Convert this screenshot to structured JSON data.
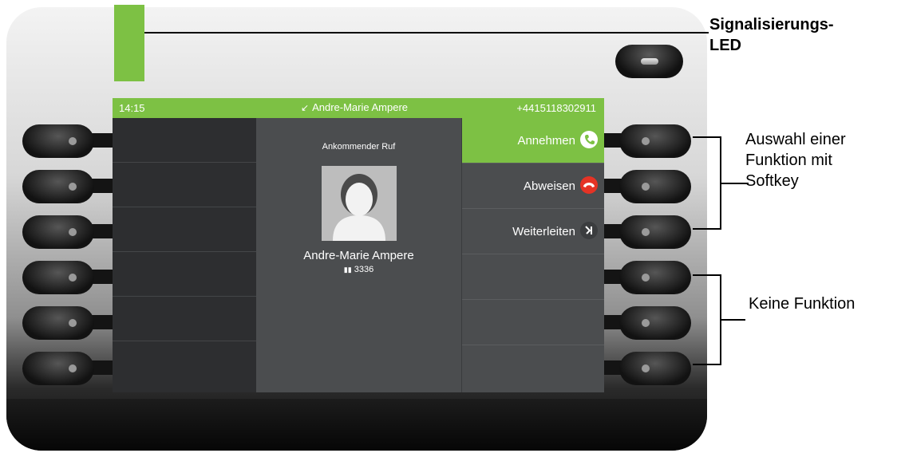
{
  "annotations": {
    "led_label_1": "Signalisierungs-",
    "led_label_2": "LED",
    "softkey_label_1": "Auswahl einer",
    "softkey_label_2": "Funktion mit",
    "softkey_label_3": "Softkey",
    "nofunction_label": "Keine Funktion"
  },
  "status": {
    "time": "14:15",
    "caller": "Andre-Marie Ampere",
    "number": "+4415118302911"
  },
  "call": {
    "heading": "Ankommender Ruf",
    "name": "Andre-Marie Ampere",
    "extension": "3336"
  },
  "softkeys": [
    {
      "label": "Annehmen",
      "icon": "answer-phone-icon"
    },
    {
      "label": "Abweisen",
      "icon": "reject-phone-icon"
    },
    {
      "label": "Weiterleiten",
      "icon": "forward-icon"
    }
  ],
  "colors": {
    "accent": "#7dc144",
    "reject": "#e53325",
    "screen": "#4b4d4f"
  }
}
